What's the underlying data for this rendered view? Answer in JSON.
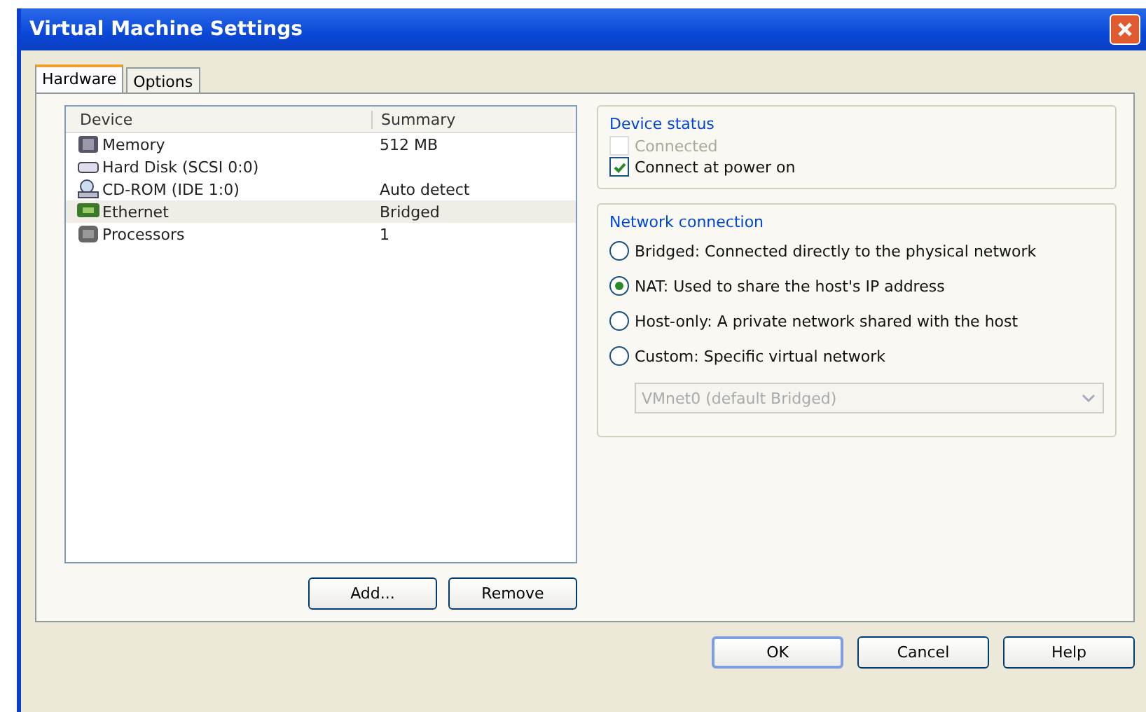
{
  "window": {
    "title": "Virtual Machine Settings"
  },
  "tabs": [
    {
      "label": "Hardware",
      "selected": true
    },
    {
      "label": "Options",
      "selected": false
    }
  ],
  "device_list": {
    "columns": [
      "Device",
      "Summary"
    ],
    "rows": [
      {
        "kind": "memory",
        "device": "Memory",
        "summary": "512 MB",
        "selected": false
      },
      {
        "kind": "disk",
        "device": "Hard Disk (SCSI 0:0)",
        "selected": false
      },
      {
        "kind": "cdrom",
        "device": "CD-ROM (IDE 1:0)",
        "summary": "Auto detect",
        "selected": false
      },
      {
        "kind": "network",
        "device": "Ethernet",
        "summary": "Bridged",
        "selected": true
      },
      {
        "kind": "processor",
        "device": "Processors",
        "summary": "1",
        "selected": false
      }
    ]
  },
  "list_buttons": [
    "Add...",
    "Remove"
  ],
  "device_status": {
    "title": "Device status",
    "options": [
      {
        "label": "Connected",
        "checked": false,
        "disabled": true
      },
      {
        "label": "Connect at power on",
        "checked": true,
        "disabled": false
      }
    ]
  },
  "network_connection": {
    "title": "Network connection",
    "options": [
      {
        "label": "Bridged: Connected directly to the physical network",
        "selected": false
      },
      {
        "label": "NAT: Used to share the host's IP address",
        "selected": true
      },
      {
        "label": "Host-only: A private network shared with the host",
        "selected": false
      },
      {
        "label": "Custom: Specific virtual network",
        "selected": false
      }
    ],
    "network_select": {
      "value": "VMnet0 (default Bridged)",
      "disabled": true
    }
  },
  "dialog_buttons": [
    "OK",
    "Cancel",
    "Help"
  ]
}
